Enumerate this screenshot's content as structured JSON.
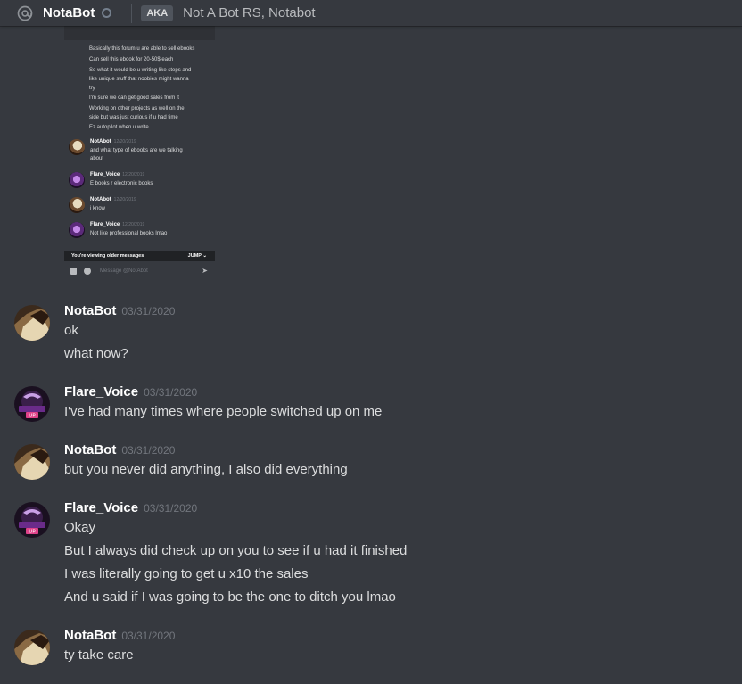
{
  "header": {
    "channel_name": "NotaBot",
    "aka_label": "AKA",
    "aka_names": "Not A Bot RS, Notabot"
  },
  "embedded": {
    "top_lines": [
      "Basically this forum u are able to sell ebooks",
      "Can sell this ebook for 20-50$ each",
      "So what it would be u writing like steps and",
      "like unique stuff that noobies might wanna",
      "try",
      "I'm sure we can get good sales from it",
      "Working on other projects as well on the",
      "side but was just curious if u had time",
      "Ez autopilot when u write"
    ],
    "messages": [
      {
        "author": "NotAbot",
        "time": "12/20/2019",
        "lines": [
          "and what type of ebooks are we talking",
          "about"
        ]
      },
      {
        "author": "Flare_Voice",
        "time": "12/20/2019",
        "lines": [
          "E books r electronic books"
        ]
      },
      {
        "author": "NotAbot",
        "time": "12/20/2019",
        "lines": [
          "i know"
        ]
      },
      {
        "author": "Flare_Voice",
        "time": "12/20/2019",
        "lines": [
          "Not like professional books lmao"
        ]
      }
    ],
    "older_messages_label": "You're viewing older messages",
    "jump_label": "JUMP",
    "input_placeholder": "Message @NotAbot"
  },
  "messages": [
    {
      "author": "NotaBot",
      "time": "03/31/2020",
      "lines": [
        "ok",
        "what now?"
      ]
    },
    {
      "author": "Flare_Voice",
      "time": "03/31/2020",
      "lines": [
        "I've had many times where people switched up on me"
      ]
    },
    {
      "author": "NotaBot",
      "time": "03/31/2020",
      "lines": [
        "but you never did anything, I also did everything"
      ]
    },
    {
      "author": "Flare_Voice",
      "time": "03/31/2020",
      "lines": [
        "Okay",
        "But I always did check up on you to see if u had it finished",
        "I was literally going to get u x10 the sales",
        "And u said if I was going to be the one to ditch you lmao"
      ]
    },
    {
      "author": "NotaBot",
      "time": "03/31/2020",
      "lines": [
        "ty take care"
      ]
    }
  ],
  "avatar_badge_text": "UP",
  "colors": {
    "background": "#36393f",
    "text": "#dcddde",
    "timestamp": "#72767d"
  }
}
